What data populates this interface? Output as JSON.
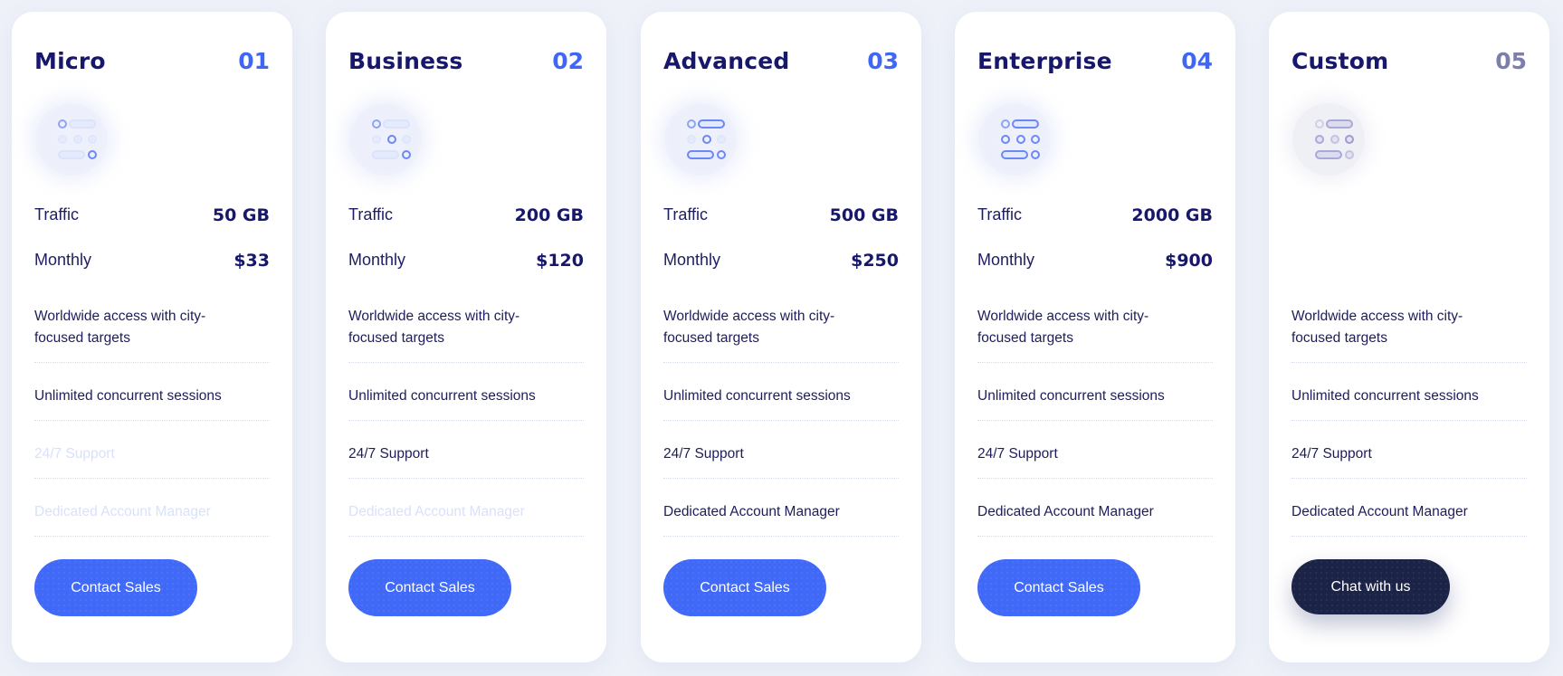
{
  "colors": {
    "background": "#eef1f8",
    "title": "#17176b",
    "accent_blue": "#3f66f5",
    "button_blue": "#4169f7",
    "button_dark": "#1b2347",
    "muted_number": "#7b7fa9",
    "disabled_feature": "#d9e1fb"
  },
  "labels": {
    "traffic": "Traffic",
    "monthly": "Monthly"
  },
  "plans": [
    {
      "name": "Micro",
      "number": "01",
      "icon": "plan-tier-icon",
      "traffic": "50 GB",
      "monthly": "$33",
      "features": [
        {
          "text": "Worldwide access with city-focused targets",
          "enabled": true
        },
        {
          "text": "Unlimited concurrent sessions",
          "enabled": true
        },
        {
          "text": "24/7 Support",
          "enabled": false
        },
        {
          "text": "Dedicated Account Manager",
          "enabled": false
        }
      ],
      "button": "Contact Sales"
    },
    {
      "name": "Business",
      "number": "02",
      "icon": "plan-tier-icon",
      "traffic": "200 GB",
      "monthly": "$120",
      "features": [
        {
          "text": "Worldwide access with city-focused targets",
          "enabled": true
        },
        {
          "text": "Unlimited concurrent sessions",
          "enabled": true
        },
        {
          "text": "24/7 Support",
          "enabled": true
        },
        {
          "text": "Dedicated Account Manager",
          "enabled": false
        }
      ],
      "button": "Contact Sales"
    },
    {
      "name": "Advanced",
      "number": "03",
      "icon": "plan-tier-icon",
      "traffic": "500 GB",
      "monthly": "$250",
      "features": [
        {
          "text": "Worldwide access with city-focused targets",
          "enabled": true
        },
        {
          "text": "Unlimited concurrent sessions",
          "enabled": true
        },
        {
          "text": "24/7 Support",
          "enabled": true
        },
        {
          "text": "Dedicated Account Manager",
          "enabled": true
        }
      ],
      "button": "Contact Sales"
    },
    {
      "name": "Enterprise",
      "number": "04",
      "icon": "plan-tier-icon",
      "traffic": "2000 GB",
      "monthly": "$900",
      "features": [
        {
          "text": "Worldwide access with city-focused targets",
          "enabled": true
        },
        {
          "text": "Unlimited concurrent sessions",
          "enabled": true
        },
        {
          "text": "24/7 Support",
          "enabled": true
        },
        {
          "text": "Dedicated Account Manager",
          "enabled": true
        }
      ],
      "button": "Contact Sales"
    },
    {
      "name": "Custom",
      "number": "05",
      "icon": "plan-tier-icon",
      "features": [
        {
          "text": "Worldwide access with city-focused targets",
          "enabled": true
        },
        {
          "text": "Unlimited concurrent sessions",
          "enabled": true
        },
        {
          "text": "24/7 Support",
          "enabled": true
        },
        {
          "text": "Dedicated Account Manager",
          "enabled": true
        }
      ],
      "button": "Chat with us"
    }
  ]
}
